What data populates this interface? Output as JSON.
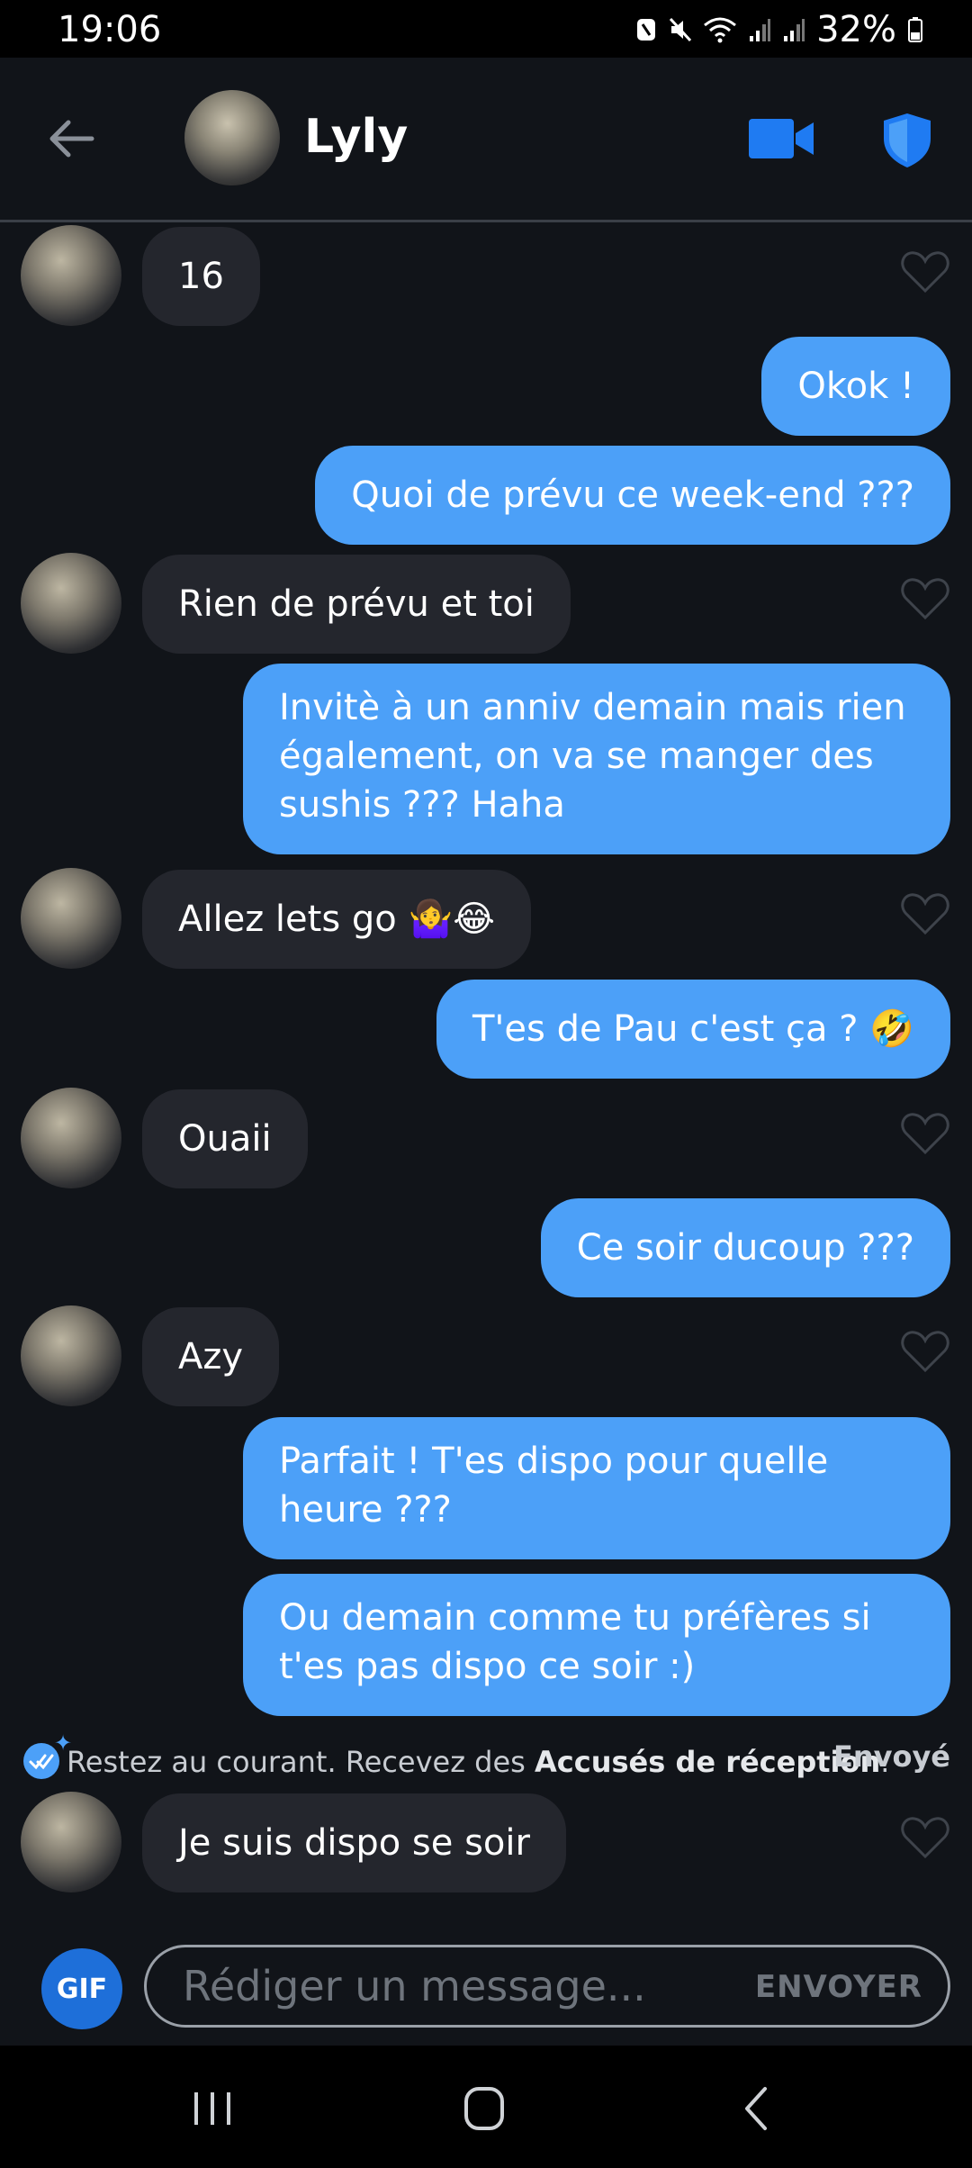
{
  "status": {
    "time": "19:06",
    "battery": "32%"
  },
  "header": {
    "name": "Lyly",
    "icons": [
      "back-arrow-icon",
      "video-call-icon",
      "shield-icon"
    ]
  },
  "messages": [
    {
      "dir": "in",
      "text": "16"
    },
    {
      "dir": "out",
      "text": "Okok !"
    },
    {
      "dir": "out",
      "text": "Quoi de prévu ce week-end ???"
    },
    {
      "dir": "in",
      "text": "Rien de prévu et toi"
    },
    {
      "dir": "out",
      "lines": [
        "Invitè à un anniv demain mais rien",
        "également, on va se manger des",
        "sushis ??? Haha"
      ]
    },
    {
      "dir": "in",
      "text": "Allez lets go 🤷‍♀️😂"
    },
    {
      "dir": "out",
      "text": "T'es de Pau c'est ça ? 🤣"
    },
    {
      "dir": "in",
      "text": "Ouaii"
    },
    {
      "dir": "out",
      "text": "Ce soir ducoup ???"
    },
    {
      "dir": "in",
      "text": "Azy"
    },
    {
      "dir": "out",
      "lines": [
        "Parfait ! T'es dispo pour quelle",
        "heure ???"
      ]
    },
    {
      "dir": "out",
      "lines": [
        "Ou demain comme tu préfères si",
        "t'es pas dispo ce soir :)"
      ]
    },
    {
      "dir": "in",
      "text": "Je suis dispo se soir"
    }
  ],
  "receipt": {
    "prefix": "Restez au courant. Recevez des ",
    "bold": "Accusés de réception",
    "suffix": ".",
    "status": "Envoyé"
  },
  "composer": {
    "gif": "GIF",
    "placeholder": "Rédiger un message...",
    "send": "ENVOYER"
  },
  "colors": {
    "accent": "#4ca0f8",
    "background": "#111419",
    "incoming": "#24262d"
  }
}
